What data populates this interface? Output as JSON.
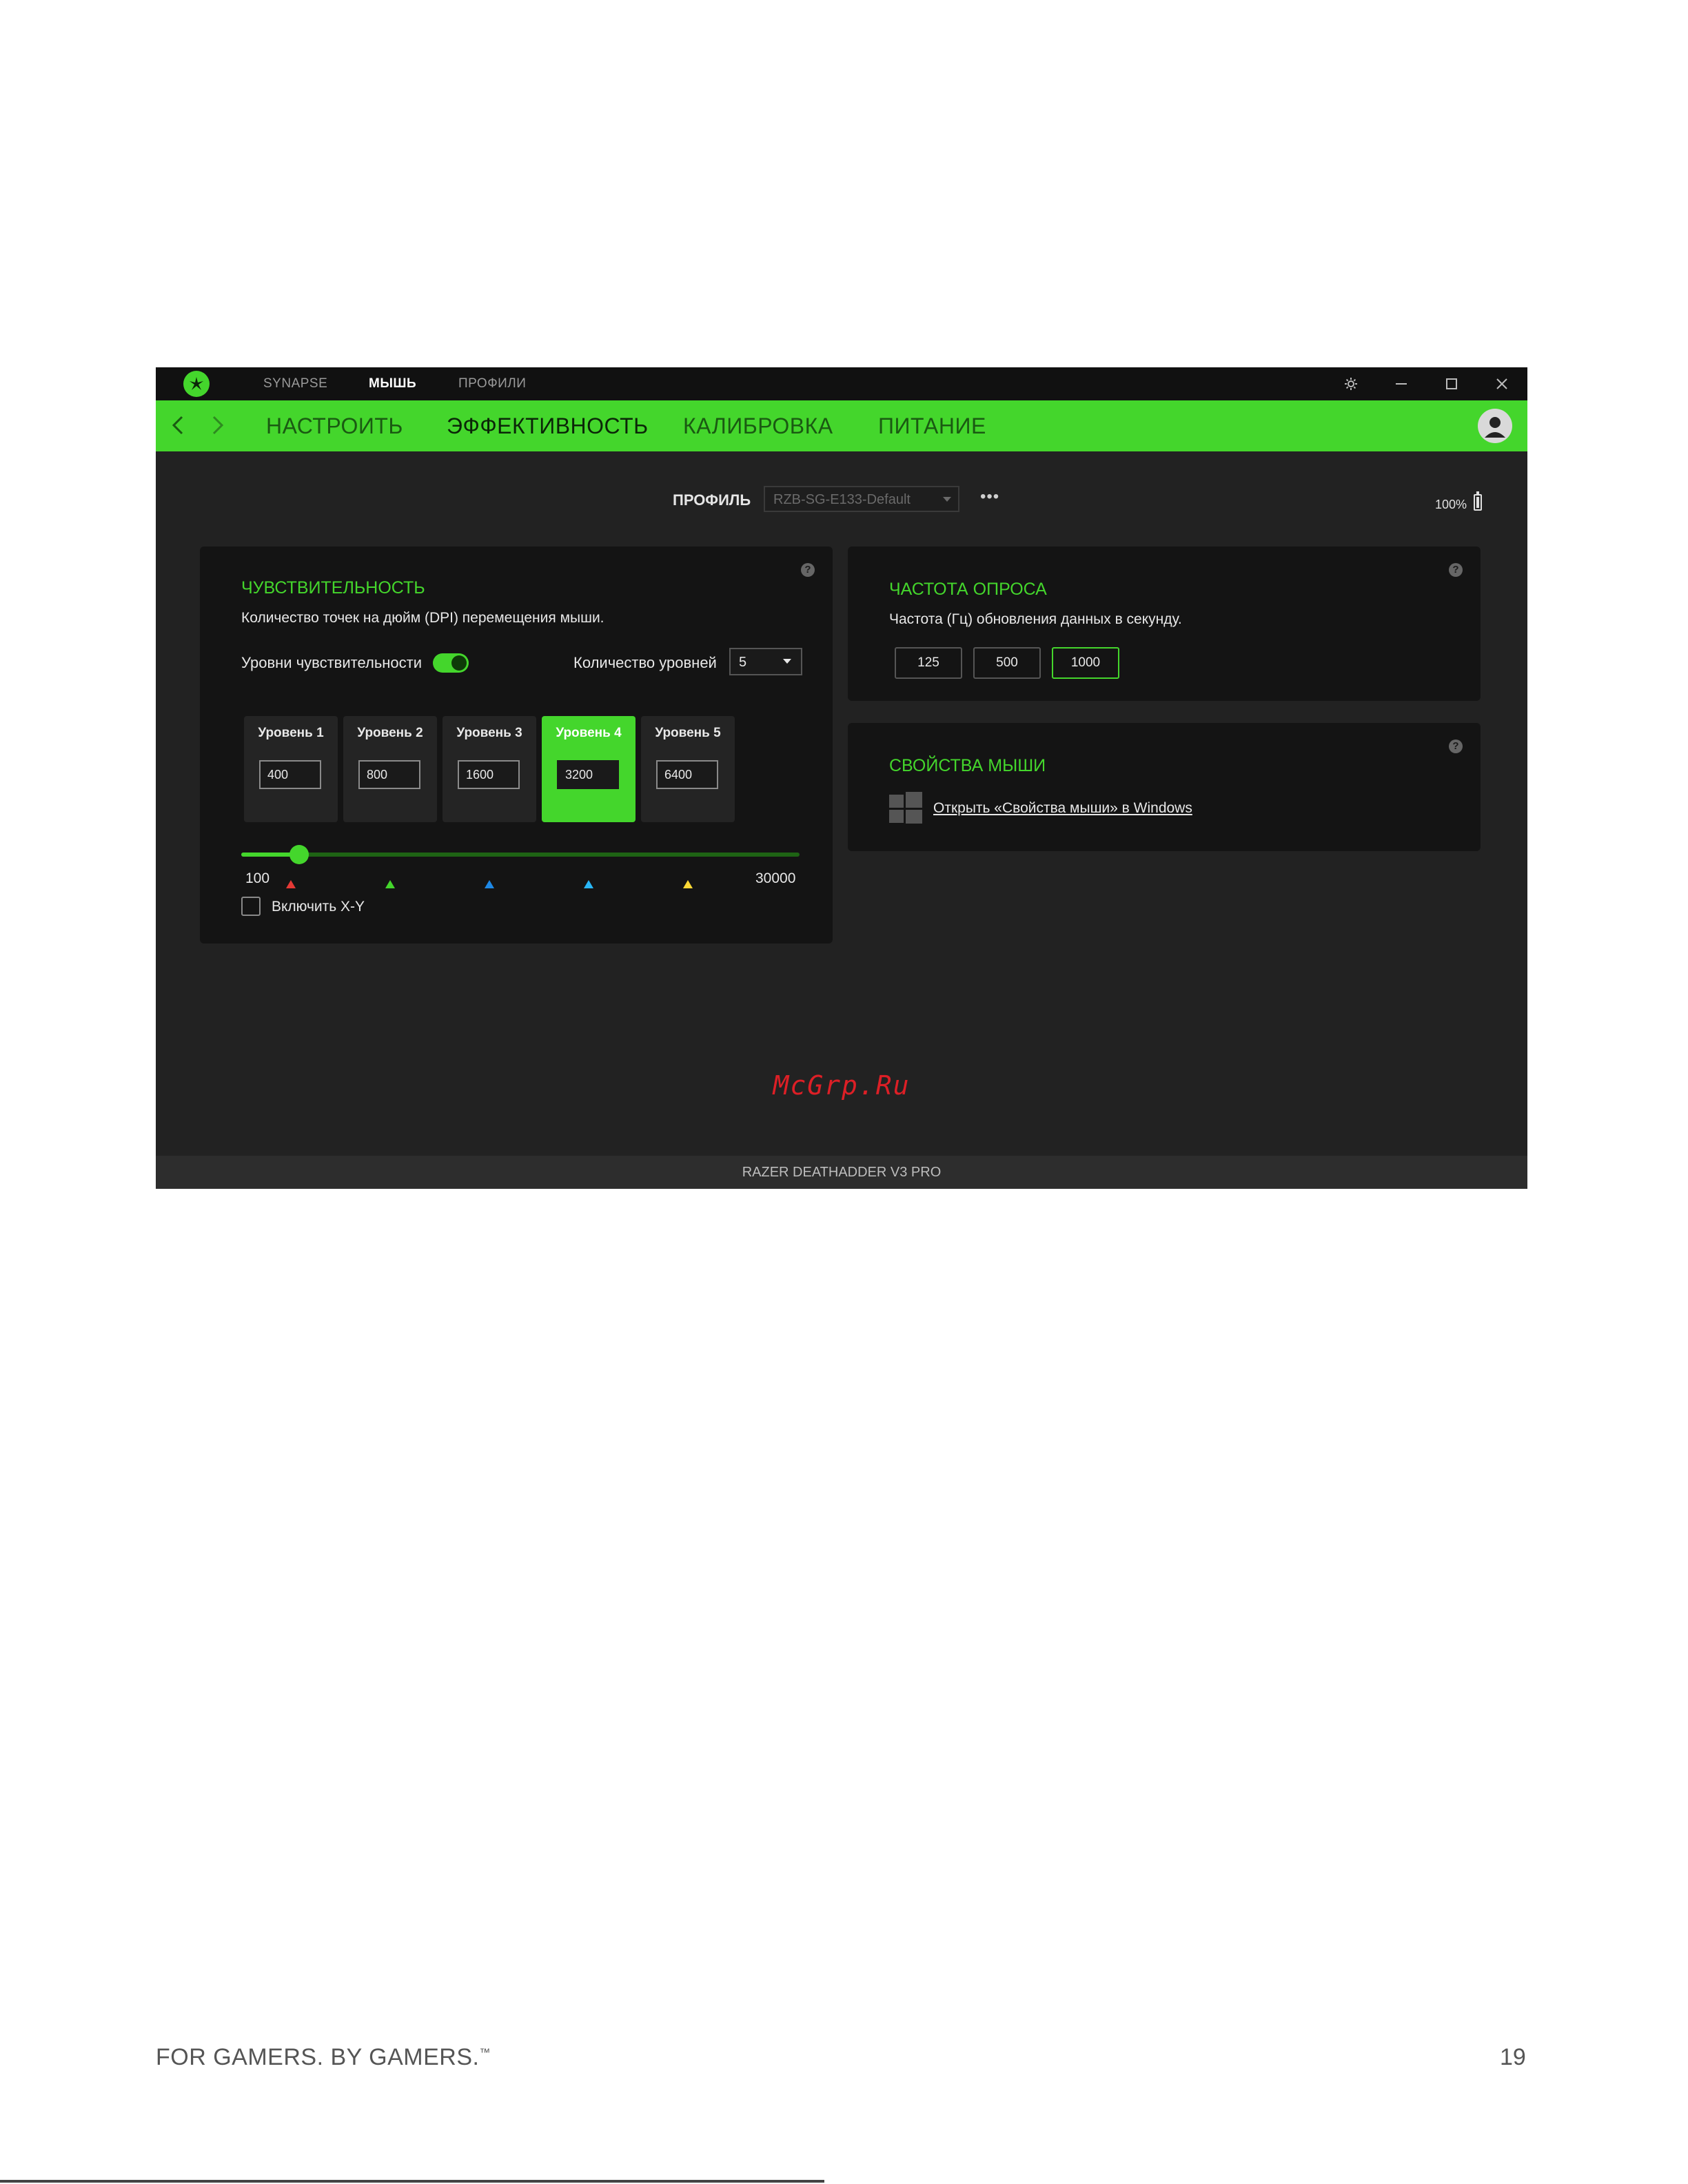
{
  "topnav": {
    "items": [
      {
        "label": "SYNAPSE",
        "active": false
      },
      {
        "label": "МЫШЬ",
        "active": true
      },
      {
        "label": "ПРОФИЛИ",
        "active": false
      }
    ]
  },
  "subnav": {
    "tabs": [
      {
        "label": "НАСТРОИТЬ"
      },
      {
        "label": "ЭФФЕКТИВНОСТЬ"
      },
      {
        "label": "КАЛИБРОВКА"
      },
      {
        "label": "ПИТАНИЕ"
      }
    ],
    "active_tab": "ЭФФЕКТИВНОСТЬ"
  },
  "profile": {
    "label": "ПРОФИЛЬ",
    "value": "RZB-SG-E133-Default",
    "more": "•••"
  },
  "battery": {
    "level": "100%"
  },
  "sensitivity": {
    "title": "ЧУВСТВИТЕЛЬНОСТЬ",
    "description": "Количество точек на дюйм (DPI) перемещения мыши.",
    "stages_label": "Уровни чувствительности",
    "stages_enabled": true,
    "count_label": "Количество уровней",
    "count_value": "5",
    "stages": [
      {
        "name": "Уровень 1",
        "value": "400",
        "marker_color": "#e53935"
      },
      {
        "name": "Уровень 2",
        "value": "800",
        "marker_color": "#44d62c"
      },
      {
        "name": "Уровень 3",
        "value": "1600",
        "marker_color": "#1e88e5"
      },
      {
        "name": "Уровень 4",
        "value": "3200",
        "marker_color": "#29b6f6",
        "active": true
      },
      {
        "name": "Уровень 5",
        "value": "6400",
        "marker_color": "#fdd835"
      }
    ],
    "slider": {
      "min": "100",
      "max": "30000",
      "value": 3200
    },
    "xy_label": "Включить X-Y",
    "xy_enabled": false
  },
  "polling": {
    "title": "ЧАСТОТА ОПРОСА",
    "description": "Частота (Гц) обновления данных в секунду.",
    "options": [
      "125",
      "500",
      "1000"
    ],
    "selected": "1000"
  },
  "mouse_props": {
    "title": "СВОЙСТВА МЫШИ",
    "link": "Открыть «Свойства мыши» в Windows"
  },
  "help_glyph": "?",
  "watermark": "McGrp.Ru",
  "device_name": "RAZER DEATHADDER V3 PRO",
  "footer": {
    "slogan": "FOR GAMERS. BY GAMERS.",
    "tm": "™",
    "page": "19"
  },
  "colors": {
    "accent": "#44d62c",
    "background": "#222222",
    "panel": "#141414"
  },
  "icons": [
    "razer-logo-icon",
    "gear-icon",
    "minimize-icon",
    "maximize-icon",
    "close-icon",
    "back-arrow-icon",
    "forward-arrow-icon",
    "user-avatar-icon",
    "battery-icon",
    "help-icon",
    "windows-logo-icon",
    "dropdown-caret-icon"
  ]
}
